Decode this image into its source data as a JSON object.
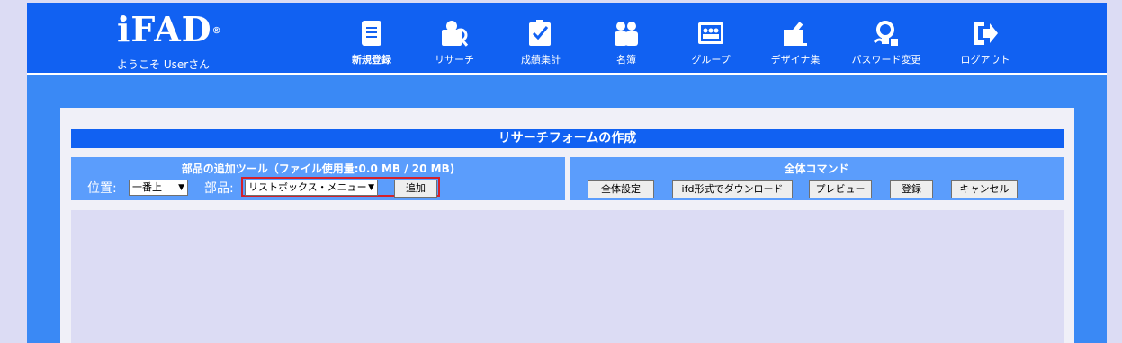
{
  "header": {
    "logo": "iFAD",
    "logo_mark": "®",
    "welcome": "ようこそ Userさん"
  },
  "nav": {
    "items": [
      {
        "label": "新規登録",
        "icon": "document-icon"
      },
      {
        "label": "リサーチ",
        "icon": "research-icon"
      },
      {
        "label": "成績集計",
        "icon": "tally-icon"
      },
      {
        "label": "名簿",
        "icon": "people-icon"
      },
      {
        "label": "グループ",
        "icon": "group-icon"
      },
      {
        "label": "デザイナ集",
        "icon": "designer-icon"
      },
      {
        "label": "パスワード変更",
        "icon": "password-icon"
      },
      {
        "label": "ログアウト",
        "icon": "logout-icon"
      }
    ]
  },
  "form": {
    "title": "リサーチフォームの作成"
  },
  "tools": {
    "heading": "部品の追加ツール（ファイル使用量:0.0 MB / 20 MB)",
    "position_label": "位置:",
    "position_value": "一番上",
    "part_label": "部品:",
    "part_value": "リストボックス・メニュー",
    "add_button": "追加"
  },
  "commands": {
    "heading": "全体コマンド",
    "buttons": [
      "全体設定",
      "ifd形式でダウンロード",
      "プレビュー",
      "登録",
      "キャンセル"
    ]
  },
  "colors": {
    "header_bg": "#1161f2",
    "frame_bg": "#3a89f5",
    "panel_bg": "#5b9dfc",
    "highlight": "#d4212a"
  }
}
